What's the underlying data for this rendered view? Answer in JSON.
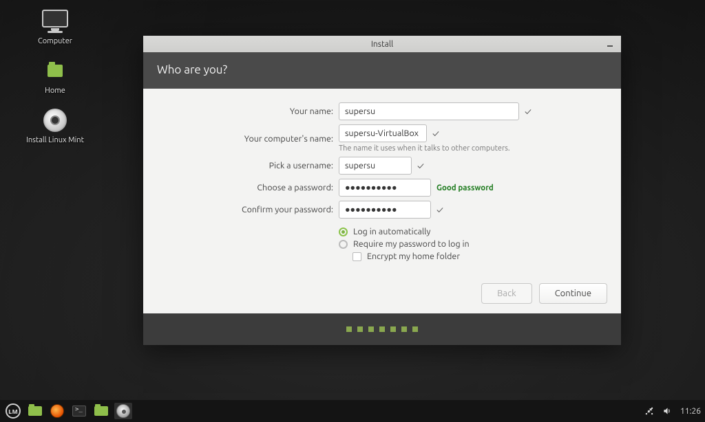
{
  "desktop": {
    "icons": {
      "computer": "Computer",
      "home": "Home",
      "install": "Install Linux Mint"
    }
  },
  "installer": {
    "window_title": "Install",
    "heading": "Who are you?",
    "labels": {
      "name": "Your name:",
      "computer": "Your computer's name:",
      "computer_hint": "The name it uses when it talks to other computers.",
      "username": "Pick a username:",
      "password": "Choose a password:",
      "confirm": "Confirm your password:"
    },
    "values": {
      "name": "supersu",
      "computer": "supersu-VirtualBox",
      "username": "supersu",
      "password": "●●●●●●●●●●",
      "confirm": "●●●●●●●●●●"
    },
    "password_strength": "Good password",
    "options": {
      "auto_login": "Log in automatically",
      "require_pw": "Require my password to log in",
      "encrypt": "Encrypt my home folder"
    },
    "buttons": {
      "back": "Back",
      "continue": "Continue"
    }
  },
  "taskbar": {
    "clock": "11:26"
  }
}
